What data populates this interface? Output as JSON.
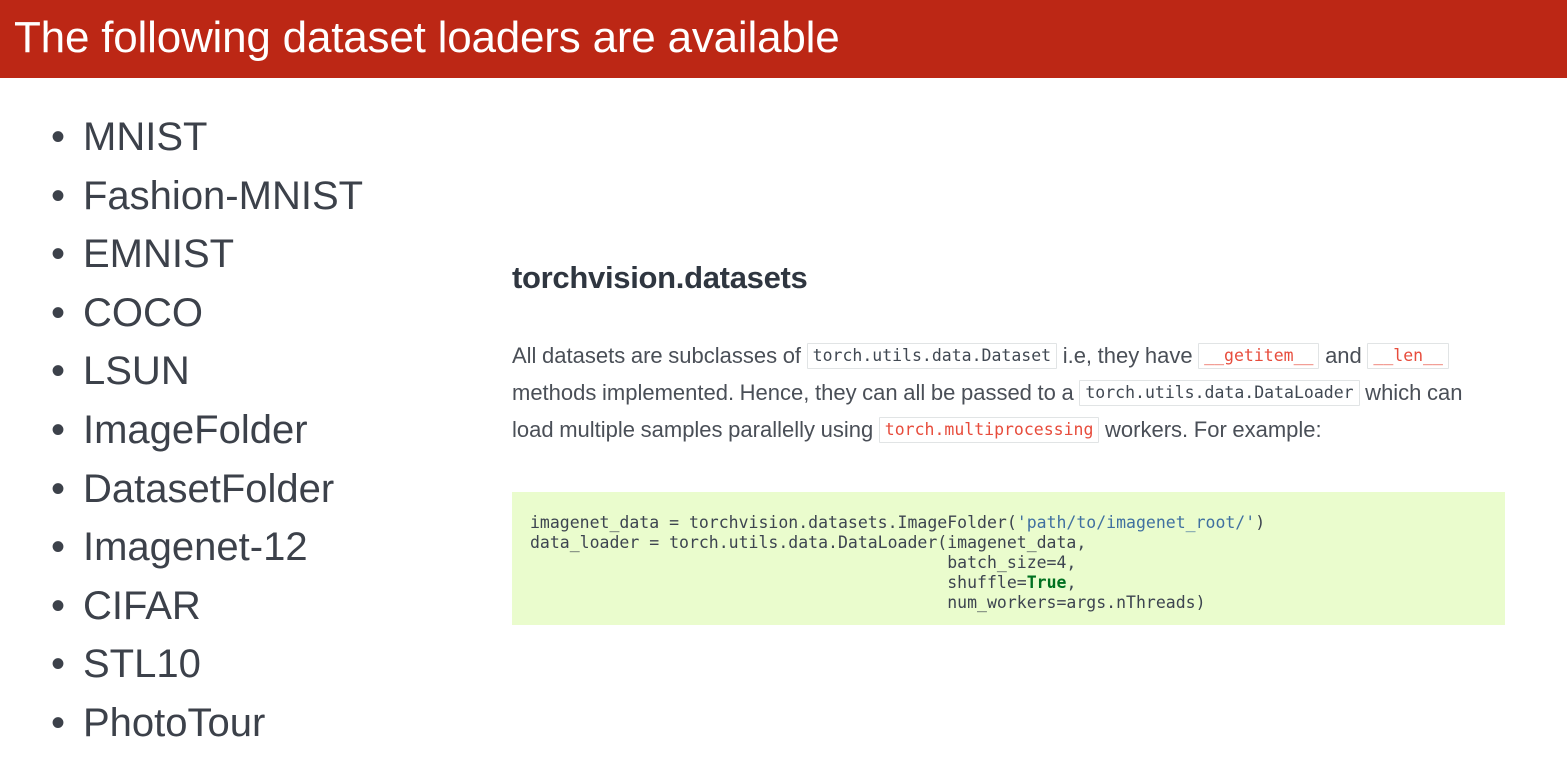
{
  "slide": {
    "title": "The following dataset loaders are available",
    "title_bar_color": "#bc2715",
    "title_text_color": "#ffffff"
  },
  "dataset_list": {
    "bullet_glyph": "•",
    "items": [
      {
        "label": "MNIST"
      },
      {
        "label": "Fashion-MNIST"
      },
      {
        "label": "EMNIST"
      },
      {
        "label": "COCO"
      },
      {
        "label": "LSUN"
      },
      {
        "label": "ImageFolder"
      },
      {
        "label": "DatasetFolder"
      },
      {
        "label": "Imagenet-12"
      },
      {
        "label": "CIFAR"
      },
      {
        "label": "STL10"
      },
      {
        "label": "PhotoTour"
      }
    ]
  },
  "doc": {
    "heading": "torchvision.datasets",
    "paragraph": {
      "part1": "All datasets are subclasses of ",
      "code1": "torch.utils.data.Dataset",
      "part2": " i.e, they have ",
      "code2": "__getitem__",
      "part3": " and ",
      "code3": "__len__",
      "part4": " methods implemented. Hence, they can all be passed to a ",
      "code4": "torch.utils.data.DataLoader",
      "part5": " which can load multiple samples parallelly using ",
      "code5": "torch.multiprocessing",
      "part6": " workers. For example:"
    },
    "code_accent_color": "#e74c3c",
    "code_neutral_color": "#404852"
  },
  "code_block": {
    "background_color": "#eafccd",
    "line1_a": "imagenet_data = torchvision.datasets.ImageFolder(",
    "line1_str": "'path/to/imagenet_root/'",
    "line1_b": ")",
    "line2": "data_loader = torch.utils.data.DataLoader(imagenet_data,",
    "line3": "                                          batch_size=4,",
    "line4_a": "                                          shuffle=",
    "line4_kw": "True",
    "line4_b": ",",
    "line5": "                                          num_workers=args.nThreads)",
    "string_color": "#4070a0",
    "keyword_color": "#007020"
  }
}
